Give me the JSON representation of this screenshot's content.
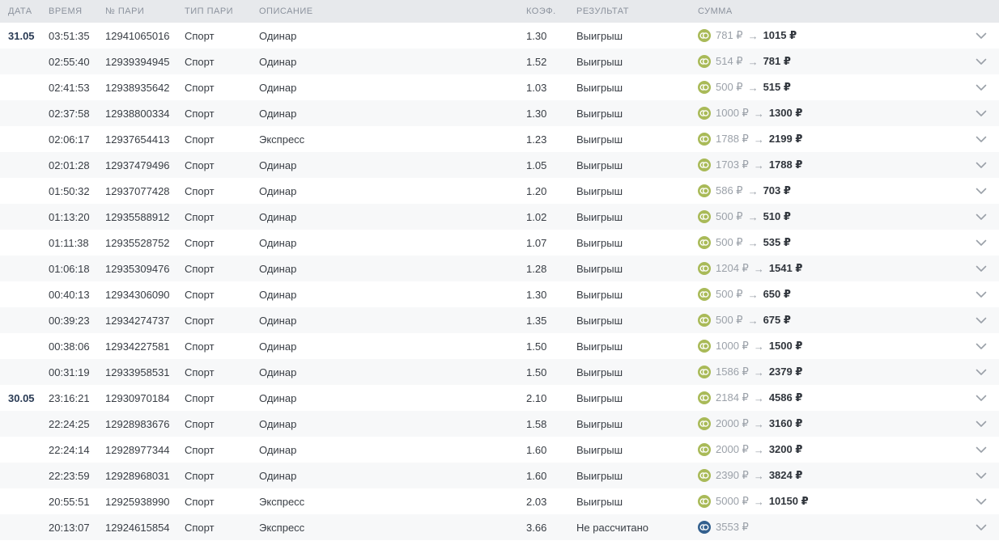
{
  "colors": {
    "won": "#a9ba58",
    "pending": "#33608e",
    "header_bg": "#e7e9ec",
    "alt_row_bg": "#f7f8f9",
    "date_text": "#2a3b55"
  },
  "icons": {
    "amount": "coin-icon",
    "expand": "chevron-down-icon"
  },
  "table": {
    "columns": [
      "ДАТА",
      "ВРЕМЯ",
      "№ ПАРИ",
      "ТИП ПАРИ",
      "ОПИСАНИЕ",
      "КОЭФ.",
      "РЕЗУЛЬТАТ",
      "СУММА"
    ],
    "currency": "₽",
    "arrow": "→",
    "rows": [
      {
        "date": "31.05",
        "time": "03:51:35",
        "bet_id": "12941065016",
        "type": "Спорт",
        "description": "Одинар",
        "coef": "1.30",
        "result": "Выигрыш",
        "stake_display": "781 ₽",
        "payout_display": "1015 ₽",
        "status": "won"
      },
      {
        "date": "",
        "time": "02:55:40",
        "bet_id": "12939394945",
        "type": "Спорт",
        "description": "Одинар",
        "coef": "1.52",
        "result": "Выигрыш",
        "stake_display": "514 ₽",
        "payout_display": "781 ₽",
        "status": "won"
      },
      {
        "date": "",
        "time": "02:41:53",
        "bet_id": "12938935642",
        "type": "Спорт",
        "description": "Одинар",
        "coef": "1.03",
        "result": "Выигрыш",
        "stake_display": "500 ₽",
        "payout_display": "515 ₽",
        "status": "won"
      },
      {
        "date": "",
        "time": "02:37:58",
        "bet_id": "12938800334",
        "type": "Спорт",
        "description": "Одинар",
        "coef": "1.30",
        "result": "Выигрыш",
        "stake_display": "1000 ₽",
        "payout_display": "1300 ₽",
        "status": "won"
      },
      {
        "date": "",
        "time": "02:06:17",
        "bet_id": "12937654413",
        "type": "Спорт",
        "description": "Экспресс",
        "coef": "1.23",
        "result": "Выигрыш",
        "stake_display": "1788 ₽",
        "payout_display": "2199 ₽",
        "status": "won"
      },
      {
        "date": "",
        "time": "02:01:28",
        "bet_id": "12937479496",
        "type": "Спорт",
        "description": "Одинар",
        "coef": "1.05",
        "result": "Выигрыш",
        "stake_display": "1703 ₽",
        "payout_display": "1788 ₽",
        "status": "won"
      },
      {
        "date": "",
        "time": "01:50:32",
        "bet_id": "12937077428",
        "type": "Спорт",
        "description": "Одинар",
        "coef": "1.20",
        "result": "Выигрыш",
        "stake_display": "586 ₽",
        "payout_display": "703 ₽",
        "status": "won"
      },
      {
        "date": "",
        "time": "01:13:20",
        "bet_id": "12935588912",
        "type": "Спорт",
        "description": "Одинар",
        "coef": "1.02",
        "result": "Выигрыш",
        "stake_display": "500 ₽",
        "payout_display": "510 ₽",
        "status": "won"
      },
      {
        "date": "",
        "time": "01:11:38",
        "bet_id": "12935528752",
        "type": "Спорт",
        "description": "Одинар",
        "coef": "1.07",
        "result": "Выигрыш",
        "stake_display": "500 ₽",
        "payout_display": "535 ₽",
        "status": "won"
      },
      {
        "date": "",
        "time": "01:06:18",
        "bet_id": "12935309476",
        "type": "Спорт",
        "description": "Одинар",
        "coef": "1.28",
        "result": "Выигрыш",
        "stake_display": "1204 ₽",
        "payout_display": "1541 ₽",
        "status": "won"
      },
      {
        "date": "",
        "time": "00:40:13",
        "bet_id": "12934306090",
        "type": "Спорт",
        "description": "Одинар",
        "coef": "1.30",
        "result": "Выигрыш",
        "stake_display": "500 ₽",
        "payout_display": "650 ₽",
        "status": "won"
      },
      {
        "date": "",
        "time": "00:39:23",
        "bet_id": "12934274737",
        "type": "Спорт",
        "description": "Одинар",
        "coef": "1.35",
        "result": "Выигрыш",
        "stake_display": "500 ₽",
        "payout_display": "675 ₽",
        "status": "won"
      },
      {
        "date": "",
        "time": "00:38:06",
        "bet_id": "12934227581",
        "type": "Спорт",
        "description": "Одинар",
        "coef": "1.50",
        "result": "Выигрыш",
        "stake_display": "1000 ₽",
        "payout_display": "1500 ₽",
        "status": "won"
      },
      {
        "date": "",
        "time": "00:31:19",
        "bet_id": "12933958531",
        "type": "Спорт",
        "description": "Одинар",
        "coef": "1.50",
        "result": "Выигрыш",
        "stake_display": "1586 ₽",
        "payout_display": "2379 ₽",
        "status": "won"
      },
      {
        "date": "30.05",
        "time": "23:16:21",
        "bet_id": "12930970184",
        "type": "Спорт",
        "description": "Одинар",
        "coef": "2.10",
        "result": "Выигрыш",
        "stake_display": "2184 ₽",
        "payout_display": "4586 ₽",
        "status": "won"
      },
      {
        "date": "",
        "time": "22:24:25",
        "bet_id": "12928983676",
        "type": "Спорт",
        "description": "Одинар",
        "coef": "1.58",
        "result": "Выигрыш",
        "stake_display": "2000 ₽",
        "payout_display": "3160 ₽",
        "status": "won"
      },
      {
        "date": "",
        "time": "22:24:14",
        "bet_id": "12928977344",
        "type": "Спорт",
        "description": "Одинар",
        "coef": "1.60",
        "result": "Выигрыш",
        "stake_display": "2000 ₽",
        "payout_display": "3200 ₽",
        "status": "won"
      },
      {
        "date": "",
        "time": "22:23:59",
        "bet_id": "12928968031",
        "type": "Спорт",
        "description": "Одинар",
        "coef": "1.60",
        "result": "Выигрыш",
        "stake_display": "2390 ₽",
        "payout_display": "3824 ₽",
        "status": "won"
      },
      {
        "date": "",
        "time": "20:55:51",
        "bet_id": "12925938990",
        "type": "Спорт",
        "description": "Экспресс",
        "coef": "2.03",
        "result": "Выигрыш",
        "stake_display": "5000 ₽",
        "payout_display": "10150 ₽",
        "status": "won"
      },
      {
        "date": "",
        "time": "20:13:07",
        "bet_id": "12924615854",
        "type": "Спорт",
        "description": "Экспресс",
        "coef": "3.66",
        "result": "Не рассчитано",
        "stake_display": "3553 ₽",
        "payout_display": null,
        "status": "pending"
      }
    ]
  }
}
